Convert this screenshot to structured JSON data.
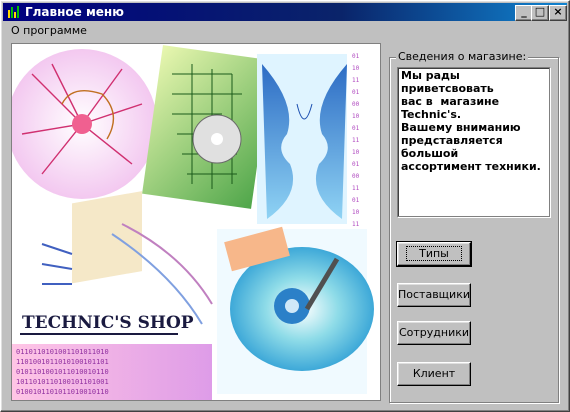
{
  "window": {
    "title": "Главное меню"
  },
  "menu": {
    "items": [
      "О программе"
    ]
  },
  "picture": {
    "caption": "TECHNIC'S SHOP"
  },
  "info": {
    "legend": "Сведения о магазине:",
    "text": "Мы рады приветсвовать\nвас в  магазине\nTechnic's.\nВашему вниманию\nпредставляется\nбольшой\nассортимент техники."
  },
  "buttons": {
    "types": "Типы",
    "suppliers": "Поставщики",
    "staff": "Сотрудники",
    "client": "Клиент"
  }
}
